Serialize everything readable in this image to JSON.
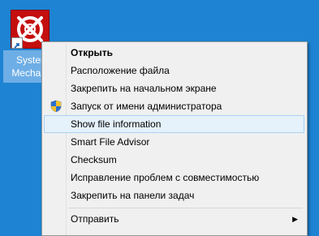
{
  "desktop": {
    "icon_caption_line1": "System",
    "icon_caption_line2": "Mechanic",
    "background_color": "#1d83d2"
  },
  "context_menu": {
    "items": [
      {
        "label": "Открыть",
        "bold": true
      },
      {
        "label": "Расположение файла"
      },
      {
        "label": "Закрепить на начальном экране"
      },
      {
        "label": "Запуск от имени администратора",
        "icon": "uac-shield-icon"
      },
      {
        "label": "Show file information",
        "highlighted": true
      },
      {
        "label": "Smart File Advisor"
      },
      {
        "label": "Checksum"
      },
      {
        "label": "Исправление проблем с совместимостью"
      },
      {
        "label": "Закрепить на панели задач"
      },
      {
        "label": "Отправить",
        "submenu": true
      }
    ],
    "submenu_arrow": "▶",
    "highlight_color": "#e5f1fb"
  }
}
